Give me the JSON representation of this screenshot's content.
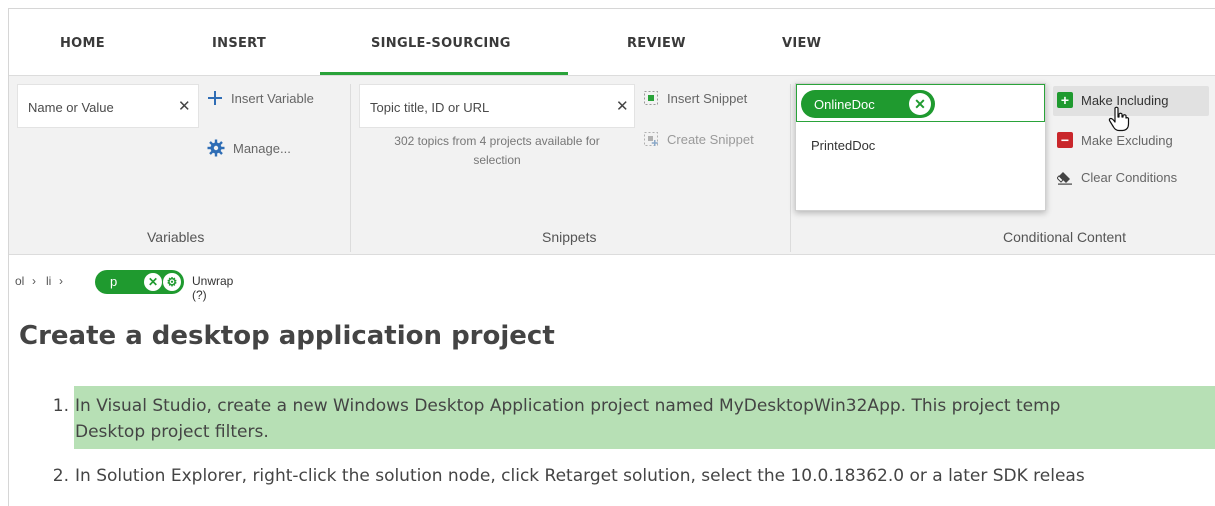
{
  "tabs": {
    "home": "HOME",
    "insert": "INSERT",
    "single_sourcing": "SINGLE-SOURCING",
    "review": "REVIEW",
    "view": "VIEW",
    "active": "SINGLE-SOURCING"
  },
  "variables": {
    "search_placeholder": "Name or Value",
    "insert_label": "Insert Variable",
    "manage_label": "Manage...",
    "group_label": "Variables"
  },
  "snippets": {
    "search_placeholder": "Topic title, ID or URL",
    "help_line1": "302 topics from 4 projects available for",
    "help_line2": "selection",
    "insert_label": "Insert Snippet",
    "create_label": "Create Snippet",
    "group_label": "Snippets"
  },
  "conditions": {
    "selected_chip": "OnlineDoc",
    "option": "PrintedDoc",
    "make_including": "Make Including",
    "make_excluding": "Make Excluding",
    "clear_conditions": "Clear Conditions",
    "group_label": "Conditional Content",
    "include_color": "#1f9a2f",
    "exclude_color": "#c9272b"
  },
  "breadcrumb": {
    "items": [
      "ol",
      "li"
    ],
    "current_tag": "p",
    "unwrap_label": "Unwrap (?)"
  },
  "document": {
    "title": "Create a desktop application project",
    "steps": [
      {
        "num": "1.",
        "line1": "In Visual Studio, create a new Windows Desktop Application project named MyDesktopWin32App. This project temp",
        "line2": "Desktop project filters."
      },
      {
        "num": "2.",
        "line1": "In Solution Explorer, right-click the solution node, click Retarget solution, select the 10.0.18362.0 or a later SDK releas"
      }
    ]
  }
}
